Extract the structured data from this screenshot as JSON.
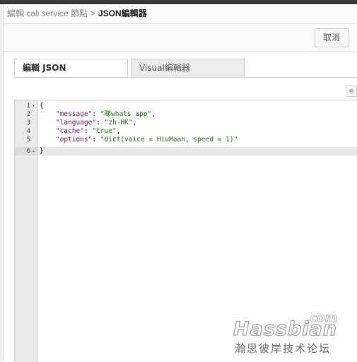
{
  "breadcrumb": {
    "parent": "編輯 call service 節點",
    "separator": ">",
    "current": "JSON編輯器"
  },
  "toolbar": {
    "cancel_label": "取消"
  },
  "tabs": [
    {
      "label": "編輯 JSON",
      "active": true
    },
    {
      "label": "Visual編輯器",
      "active": false
    }
  ],
  "editor_toolbar": {
    "button_label": "格"
  },
  "editor": {
    "line_numbers": [
      "1",
      "2",
      "3",
      "4",
      "5",
      "6"
    ],
    "lines": [
      {
        "open": "{"
      },
      {
        "key": "\"message\"",
        "value": "\"睇whats app\"",
        "comma": ","
      },
      {
        "key": "\"language\"",
        "value": "\"zh-HK\"",
        "comma": ","
      },
      {
        "key": "\"cache\"",
        "value": "\"true\"",
        "comma": ","
      },
      {
        "key": "\"options\"",
        "value": "\"dict(voice = HiuMaan, speed = 1)\"",
        "comma": ""
      },
      {
        "close": "}"
      }
    ],
    "active_line": 6,
    "colors": {
      "key": "#881280",
      "string": "#1a7b09"
    }
  },
  "watermark": {
    "domain_suffix": "com",
    "brand": "Hassbian",
    "subtitle": "瀚思彼岸技术论坛"
  }
}
